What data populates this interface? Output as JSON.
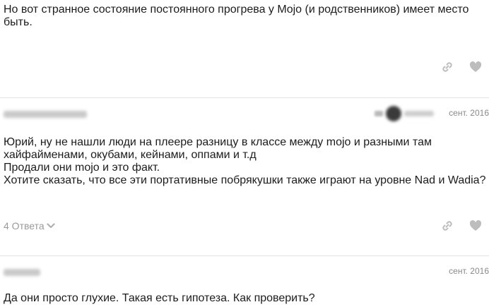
{
  "posts": [
    {
      "body_lines": [
        "Но вот странное состояние постоянного прогрева у Mojo (и родственников) имеет место",
        "быть."
      ]
    },
    {
      "date": "сент. 2016",
      "body_lines": [
        "Юрий, ну не нашли люди на плеере разницу в классе между mojo и разными там",
        "хайфайменами, окубами, кейнами, оппами и т.д",
        "Продали они mojo и это факт.",
        "Хотите сказать, что все эти портативные побрякушки также играют на уровне Nad и Wadia?"
      ],
      "replies_label": "4 Ответа"
    },
    {
      "date": "сент. 2016",
      "body_lines": [
        "Да они просто глухие. Такая есть гипотеза. Как проверить?"
      ]
    }
  ],
  "icons": {
    "link": "link-icon",
    "like": "heart-icon",
    "expand": "chevron-down-icon"
  },
  "colors": {
    "icon": "#bdbdbd",
    "muted_text": "#9a9a9a",
    "divider": "#e3e3e3"
  }
}
